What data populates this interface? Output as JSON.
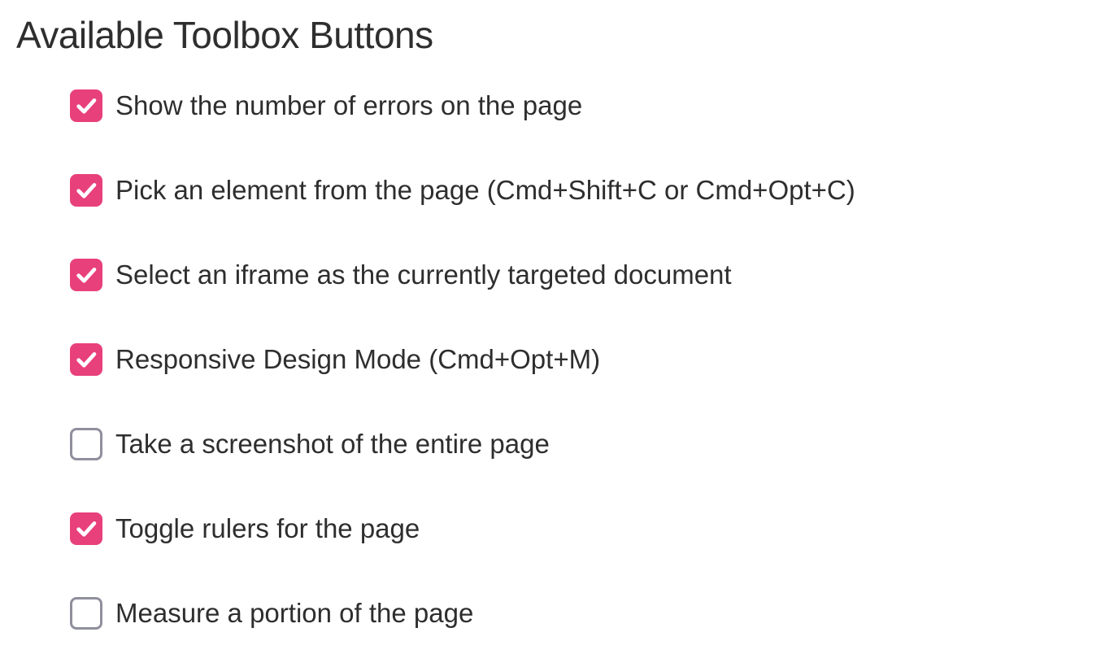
{
  "heading": "Available Toolbox Buttons",
  "options": [
    {
      "label": "Show the number of errors on the page",
      "checked": true
    },
    {
      "label": "Pick an element from the page (Cmd+Shift+C or Cmd+Opt+C)",
      "checked": true
    },
    {
      "label": "Select an iframe as the currently targeted document",
      "checked": true
    },
    {
      "label": "Responsive Design Mode (Cmd+Opt+M)",
      "checked": true
    },
    {
      "label": "Take a screenshot of the entire page",
      "checked": false
    },
    {
      "label": "Toggle rulers for the page",
      "checked": true
    },
    {
      "label": "Measure a portion of the page",
      "checked": false
    }
  ]
}
